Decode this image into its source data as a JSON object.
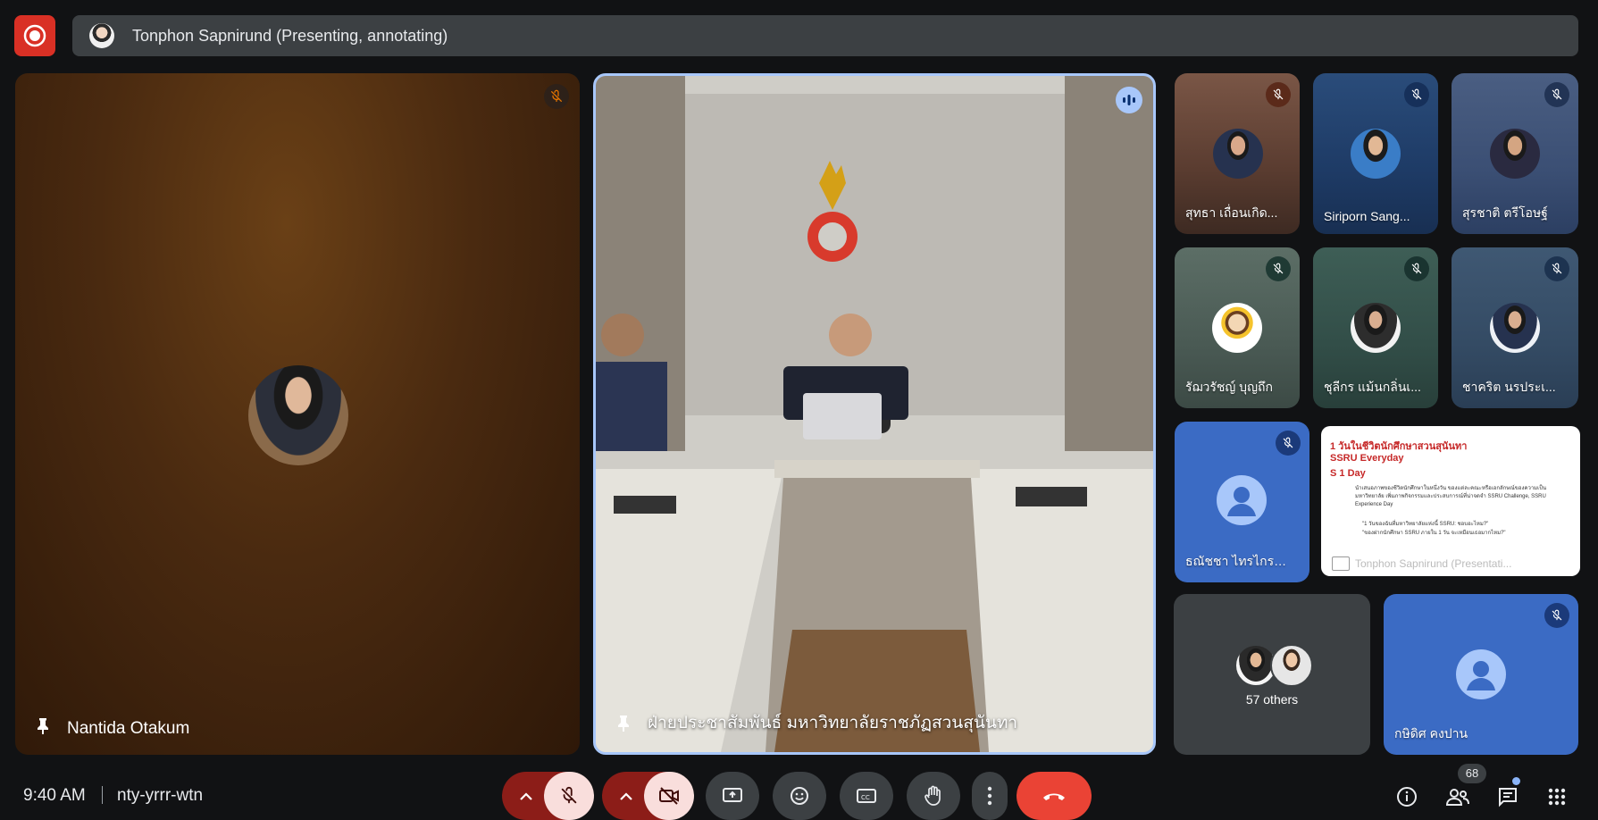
{
  "app": {
    "meeting_code": "nty-yrrr-wtn",
    "time": "9:40 AM",
    "participant_count": "68"
  },
  "presenter_banner": {
    "text": "Tonphon Sapnirund (Presenting, annotating)"
  },
  "main_tiles": [
    {
      "name": "Nantida Otakum",
      "muted": true,
      "pinned": true
    },
    {
      "name": "ฝ่ายประชาสัมพันธ์ มหาวิทยาลัยราชภัฏสวนสุนันทา",
      "speaking": true,
      "pinned": true
    }
  ],
  "grid_tiles": [
    {
      "name": "สุทธา เถื่อนเกิด...",
      "muted": true
    },
    {
      "name": "Siriporn Sang...",
      "muted": true
    },
    {
      "name": "สุรชาติ ตรีโอษฐ์",
      "muted": true
    },
    {
      "name": "รัฌวรัชญ์ บุญถึก",
      "muted": true
    },
    {
      "name": "ชุลีกร แม้นกลิ่นเ...",
      "muted": true
    },
    {
      "name": "ชาคริต นรประเ...",
      "muted": true
    },
    {
      "name": "ธณัชชา ไทรไกรกระ",
      "muted": true
    },
    {
      "name": "กษิดิศ คงปาน",
      "muted": true
    }
  ],
  "others_tile": {
    "label": "57 others"
  },
  "slide_thumb": {
    "line1": "1 วันในชีวิตนักศึกษาสวนสุนันทา",
    "line2": "SSRU Everyday",
    "line3": "S 1 Day",
    "body": "นำเสนอภาพของชีวิตนักศึกษาในหนึ่งวัน ของแต่ละคณะหรือเอกลักษณ์ของความเป็นมหาวิทยาลัย เพิ่มภาพกิจกรรมและประสบการณ์ที่น่าจดจำ SSRU Challenge, SSRU Experience Day",
    "bullet1": "\"1 วันของฉันที่มหาวิทยาลัยแห่งนี้ SSRU: ชอบอะไหม?\"",
    "bullet2": "\"ของฝากนักศึกษา SSRU ภายใน 1 วัน จะเหมือนเธอมากไหม?\"",
    "caption": "Tonphon Sapnirund (Presentati..."
  },
  "colors": {
    "accent": "#a8c7fa",
    "end_call": "#ea4335",
    "record": "#d93025",
    "muted_bg": "#f9dedc"
  },
  "icons": [
    "record-icon",
    "mic-off-icon",
    "pin-icon",
    "speaking-icon",
    "chevron-up-icon",
    "camera-off-icon",
    "present-icon",
    "emoji-icon",
    "captions-icon",
    "hand-icon",
    "more-icon",
    "end-call-icon",
    "info-icon",
    "people-icon",
    "chat-icon",
    "apps-icon"
  ]
}
